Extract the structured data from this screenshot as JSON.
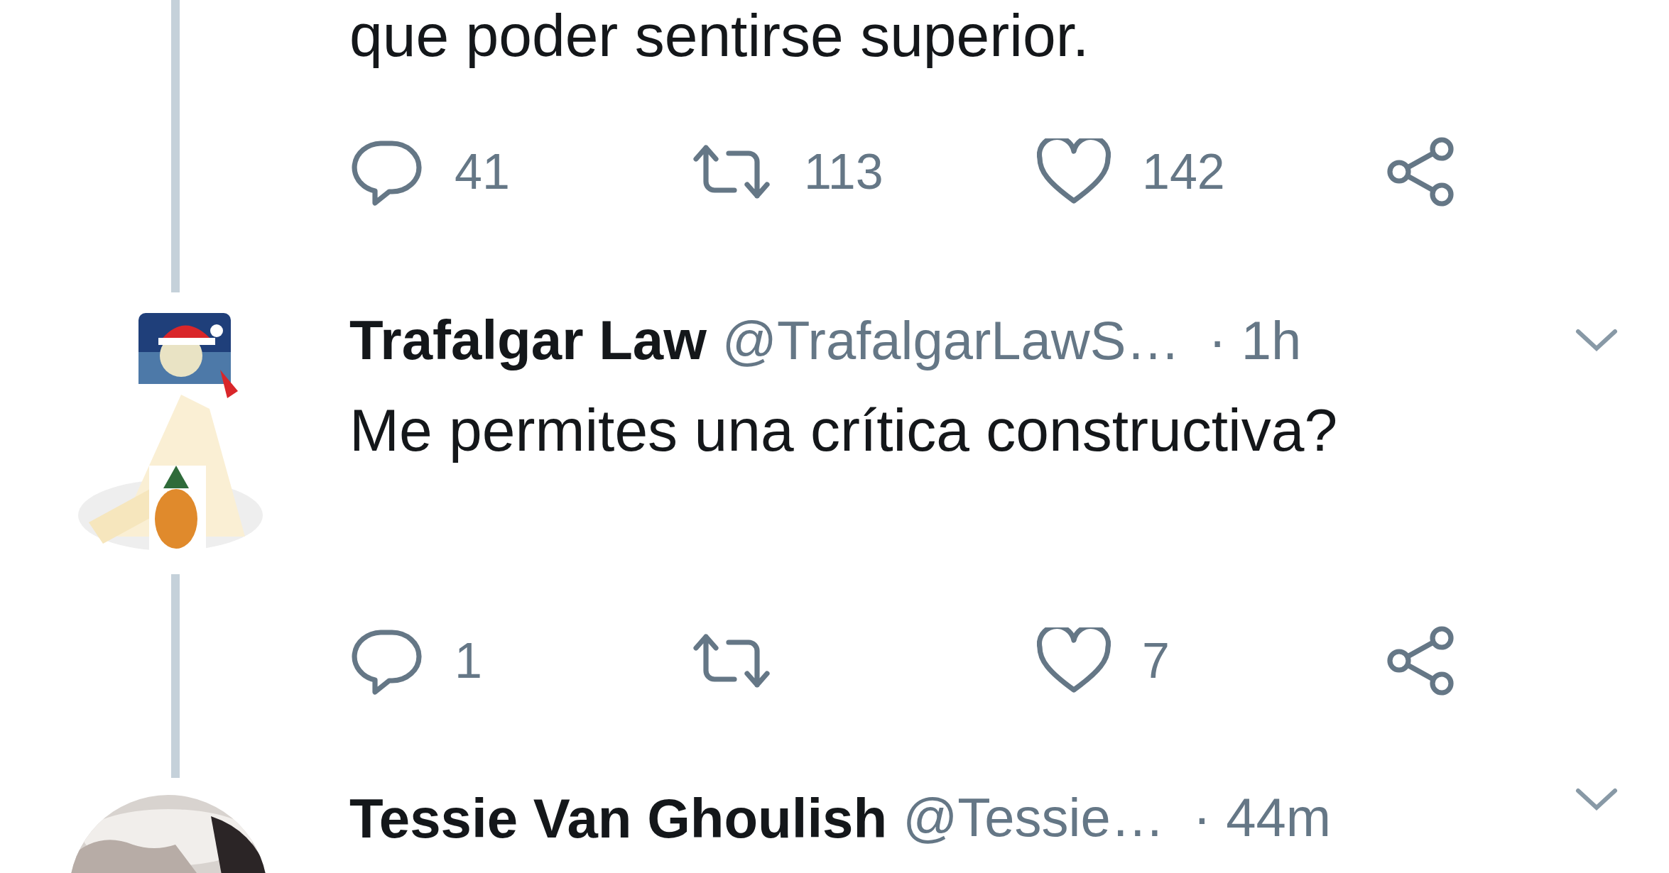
{
  "thread": [
    {
      "text": "que poder sentirse superior.",
      "actions": [
        {
          "kind": "reply",
          "count": "41"
        },
        {
          "kind": "retweet",
          "count": "113"
        },
        {
          "kind": "like",
          "count": "142"
        },
        {
          "kind": "share"
        }
      ]
    },
    {
      "name": "Trafalgar Law",
      "handle": "@TrafalgarLawS…",
      "time": "· 1h",
      "text": "Me permites una crítica constructiva?",
      "actions": [
        {
          "kind": "reply",
          "count": "1"
        },
        {
          "kind": "retweet"
        },
        {
          "kind": "like",
          "count": "7"
        },
        {
          "kind": "share"
        }
      ]
    },
    {
      "name": "Tessie Van Ghoulish",
      "handle": "@Tessie…",
      "time": "· 44m"
    }
  ]
}
